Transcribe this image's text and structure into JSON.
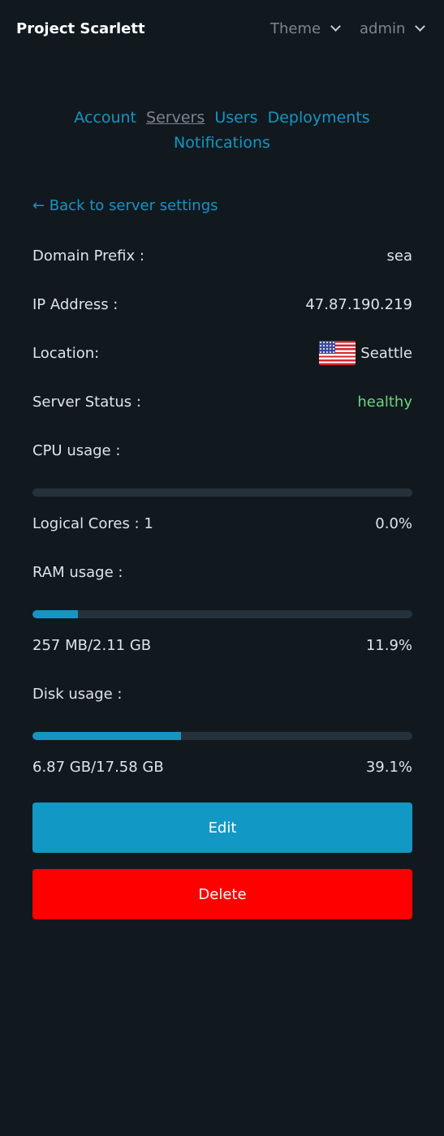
{
  "header": {
    "brand": "Project Scarlett",
    "theme_label": "Theme",
    "user_label": "admin"
  },
  "nav": {
    "items": [
      "Account",
      "Servers",
      "Users",
      "Deployments",
      "Notifications"
    ],
    "active": "Servers"
  },
  "back_link": "← Back to server settings",
  "server": {
    "domain_prefix_label": "Domain Prefix :",
    "domain_prefix": "sea",
    "ip_label": "IP Address :",
    "ip": "47.87.190.219",
    "location_label": "Location:",
    "location": "Seattle",
    "location_flag": "us-flag-icon",
    "status_label": "Server Status :",
    "status": "healthy",
    "status_color": "#6fd47a"
  },
  "cpu": {
    "label": "CPU usage :",
    "cores_text": "Logical Cores : 1",
    "percent_text": "0.0%",
    "fraction": 0.0
  },
  "ram": {
    "label": "RAM usage :",
    "amount_text": "257 MB/2.11 GB",
    "percent_text": "11.9%",
    "fraction": 0.119
  },
  "disk": {
    "label": "Disk usage :",
    "amount_text": "6.87 GB/17.58 GB",
    "percent_text": "39.1%",
    "fraction": 0.391
  },
  "actions": {
    "edit_label": "Edit",
    "delete_label": "Delete"
  },
  "colors": {
    "accent": "#1595c2",
    "danger": "#ff0000",
    "background": "#11191f"
  }
}
